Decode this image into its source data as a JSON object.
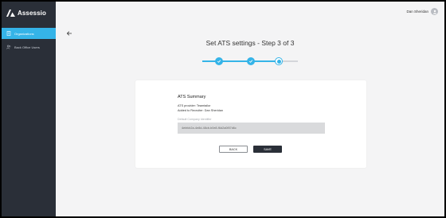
{
  "app": {
    "name": "Assessio"
  },
  "sidebar": {
    "items": [
      {
        "label": "Organizations",
        "icon": "building-icon",
        "active": true
      },
      {
        "label": "Back Office Users",
        "icon": "users-icon",
        "active": false
      }
    ]
  },
  "header": {
    "user_name": "Dan Sheridan"
  },
  "page": {
    "title": "Set ATS settings - Step 3 of 3"
  },
  "stepper": {
    "total_steps": 3,
    "current_step": 3
  },
  "summary": {
    "title": "ATS Summary",
    "lines": [
      "ATS provider: Teamtailor",
      "Added to Recruiter: Dan Sheridan"
    ],
    "field_label": "Default Company Identifier",
    "field_value": "4ebfcb2a-4e8d-48cb-b0e8-f6d2a0f87d6c"
  },
  "buttons": {
    "back_label": "BACK",
    "next_label": "SAVE"
  },
  "colors": {
    "accent": "#35b4e8",
    "sidebar_bg": "#2a2f38"
  }
}
